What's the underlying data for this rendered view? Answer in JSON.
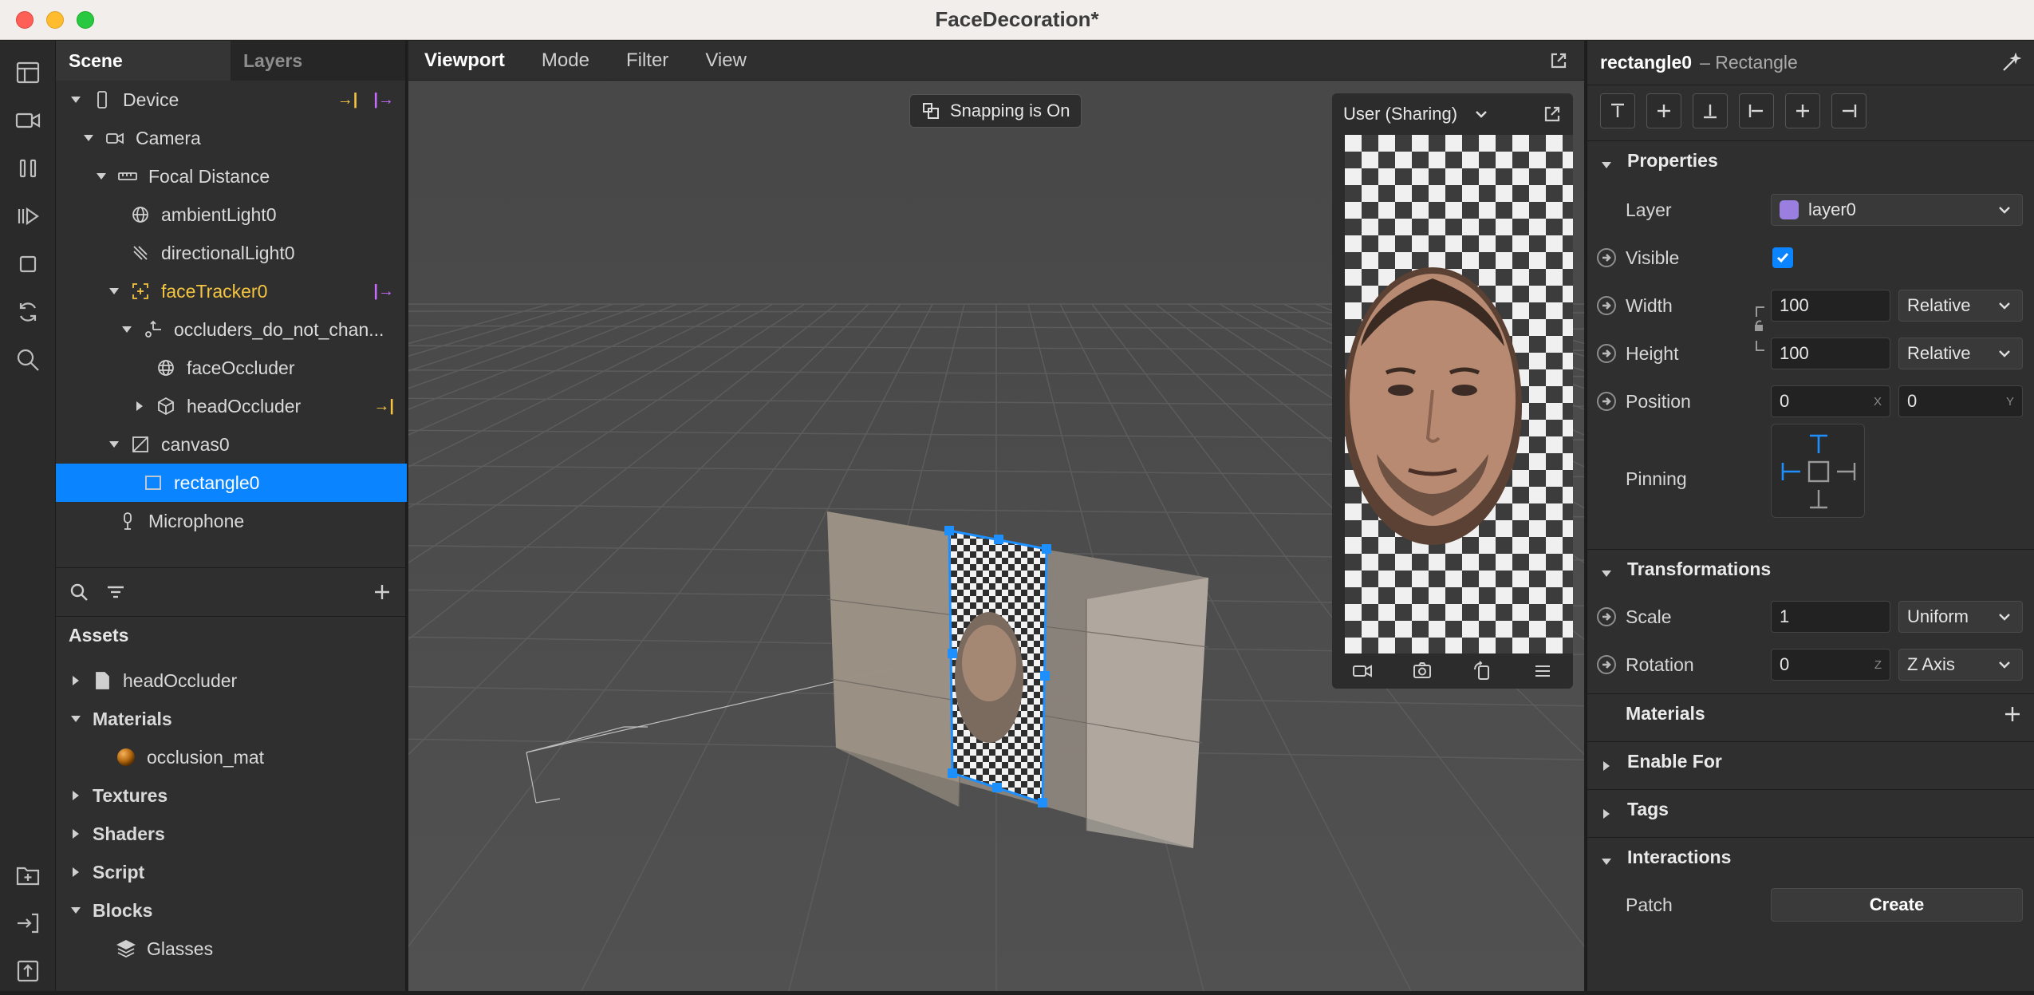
{
  "window": {
    "title": "FaceDecoration*"
  },
  "left": {
    "tabs": [
      "Scene",
      "Layers"
    ],
    "scene": [
      {
        "label": "Device",
        "indent": 0,
        "caret": "down",
        "icon": "device-icon",
        "tails": [
          "→|",
          "|→"
        ]
      },
      {
        "label": "Camera",
        "indent": 1,
        "caret": "down",
        "icon": "camera-icon",
        "tails": []
      },
      {
        "label": "Focal Distance",
        "indent": 2,
        "caret": "down",
        "icon": "ruler-icon",
        "tails": []
      },
      {
        "label": "ambientLight0",
        "indent": 3,
        "caret": "none",
        "icon": "globe-icon",
        "tails": []
      },
      {
        "label": "directionalLight0",
        "indent": 3,
        "caret": "none",
        "icon": "light-icon",
        "tails": []
      },
      {
        "label": "faceTracker0",
        "indent": 3,
        "caret": "down",
        "icon": "face-tracker-icon",
        "tails": [
          "|→"
        ],
        "highlight": true
      },
      {
        "label": "occluders_do_not_chan...",
        "indent": 4,
        "caret": "down",
        "icon": "null-object-icon",
        "tails": []
      },
      {
        "label": "faceOccluder",
        "indent": 5,
        "caret": "none",
        "icon": "mesh-icon",
        "tails": []
      },
      {
        "label": "headOccluder",
        "indent": 5,
        "caret": "right",
        "icon": "cube-icon",
        "tails": [
          "→|"
        ]
      },
      {
        "label": "canvas0",
        "indent": 3,
        "caret": "down",
        "icon": "canvas-icon",
        "tails": []
      },
      {
        "label": "rectangle0",
        "indent": 4,
        "caret": "none",
        "icon": "rectangle-icon",
        "tails": [],
        "selected": true
      },
      {
        "label": "Microphone",
        "indent": 2,
        "caret": "none",
        "icon": "microphone-icon",
        "tails": []
      }
    ],
    "assets_title": "Assets",
    "assets": [
      {
        "label": "headOccluder",
        "caret": "right",
        "icon": "file-icon",
        "bold": false,
        "indent": 0
      },
      {
        "label": "Materials",
        "caret": "down",
        "icon": "",
        "bold": true,
        "indent": 0
      },
      {
        "label": "occlusion_mat",
        "caret": "none",
        "icon": "material-sphere-icon",
        "bold": false,
        "indent": 1
      },
      {
        "label": "Textures",
        "caret": "right",
        "icon": "",
        "bold": true,
        "indent": 0
      },
      {
        "label": "Shaders",
        "caret": "right",
        "icon": "",
        "bold": true,
        "indent": 0
      },
      {
        "label": "Script",
        "caret": "right",
        "icon": "",
        "bold": true,
        "indent": 0
      },
      {
        "label": "Blocks",
        "caret": "down",
        "icon": "",
        "bold": true,
        "indent": 0
      },
      {
        "label": "Glasses",
        "caret": "none",
        "icon": "block-icon",
        "bold": false,
        "indent": 1
      }
    ]
  },
  "viewport": {
    "menus": [
      "Viewport",
      "Mode",
      "Filter",
      "View"
    ],
    "snapping": "Snapping is On",
    "preview": {
      "device": "User (Sharing)"
    }
  },
  "inspector": {
    "object_name": "rectangle0",
    "object_type": "– Rectangle",
    "sections": {
      "properties": "Properties",
      "transformations": "Transformations",
      "materials": "Materials",
      "enable_for": "Enable For",
      "tags": "Tags",
      "interactions": "Interactions"
    },
    "props": {
      "layer": {
        "label": "Layer",
        "value": "layer0",
        "color": "#9a7ee0"
      },
      "visible": {
        "label": "Visible",
        "checked": true
      },
      "width": {
        "label": "Width",
        "value": "100",
        "mode": "Relative"
      },
      "height": {
        "label": "Height",
        "value": "100",
        "mode": "Relative"
      },
      "position": {
        "label": "Position",
        "x": "0",
        "y": "0",
        "x_suffix": "X",
        "y_suffix": "Y"
      },
      "pinning": {
        "label": "Pinning"
      },
      "scale": {
        "label": "Scale",
        "value": "1",
        "mode": "Uniform"
      },
      "rotation": {
        "label": "Rotation",
        "value": "0",
        "suffix": "Z",
        "mode": "Z Axis"
      },
      "patch": {
        "label": "Patch",
        "button": "Create"
      }
    }
  }
}
